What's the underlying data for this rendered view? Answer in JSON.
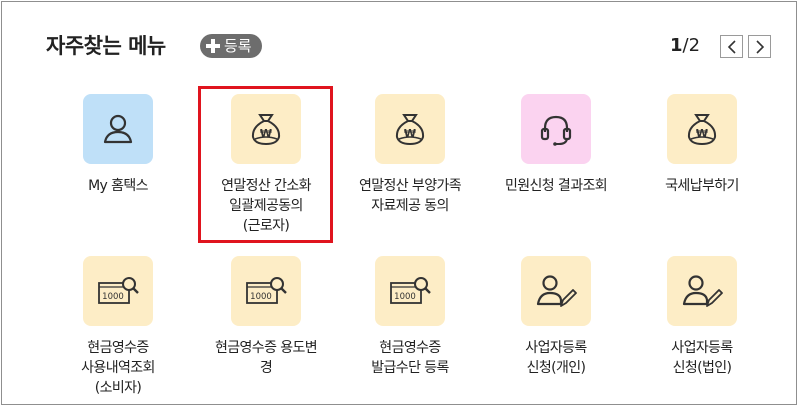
{
  "header": {
    "title": "자주찾는 메뉴",
    "register_label": "등록",
    "page_current": "1",
    "page_total": "/2"
  },
  "colors": {
    "yellow_box": "#fdedc6",
    "blue_box": "#bfe0f8",
    "pink_box": "#fbd3f0",
    "highlight": "#e0141e"
  },
  "menu_items": [
    {
      "label": "My 홈택스",
      "icon": "person-icon"
    },
    {
      "label": "연말정산 간소화\n일괄제공동의\n(근로자)",
      "icon": "money-bag-icon"
    },
    {
      "label": "연말정산 부양가족\n자료제공 동의",
      "icon": "money-bag-icon"
    },
    {
      "label": "민원신청 결과조회",
      "icon": "headset-icon"
    },
    {
      "label": "국세납부하기",
      "icon": "money-bag-icon"
    },
    {
      "label": "현금영수증\n사용내역조회\n(소비자)",
      "icon": "receipt-search-icon"
    },
    {
      "label": "현금영수증 용도변\n경",
      "icon": "receipt-search-icon"
    },
    {
      "label": "현금영수증\n발급수단 등록",
      "icon": "receipt-search-icon"
    },
    {
      "label": "사업자등록\n신청(개인)",
      "icon": "person-pen-icon"
    },
    {
      "label": "사업자등록\n신청(법인)",
      "icon": "person-pen-icon"
    }
  ],
  "receipt_amount": "1000"
}
